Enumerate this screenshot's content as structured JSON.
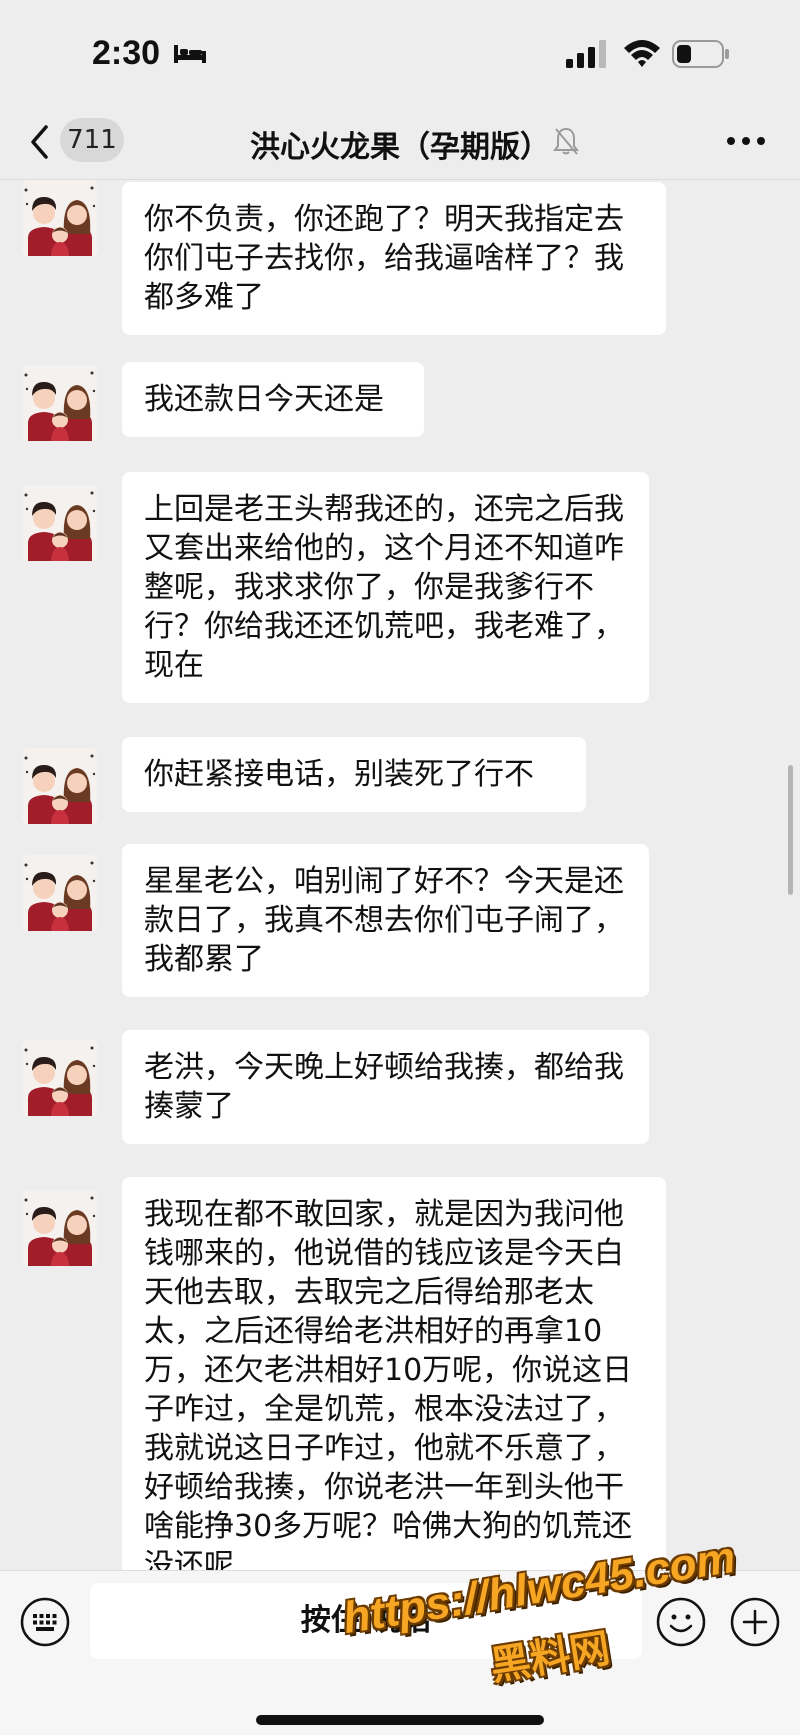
{
  "status_bar": {
    "time": "2:30",
    "icons": [
      "bed-icon",
      "signal-icon",
      "wifi-icon",
      "battery-icon"
    ]
  },
  "nav": {
    "unread_count": "711",
    "title": "洪心火龙果（孕期版）",
    "icons": [
      "back-icon",
      "mute-icon",
      "more-icon"
    ]
  },
  "messages": [
    {
      "text": "你不负责，你还跑了？明天我指定去你们屯子去找你，给我逼啥样了？我都多难了"
    },
    {
      "text": "我还款日今天还是"
    },
    {
      "text": "上回是老王头帮我还的，还完之后我又套出来给他的，这个月还不知道咋整呢，我求求你了，你是我爹行不行？你给我还还饥荒吧，我老难了，现在"
    },
    {
      "text": "你赶紧接电话，别装死了行不"
    },
    {
      "text": "星星老公，咱别闹了好不？今天是还款日了，我真不想去你们屯子闹了，我都累了"
    },
    {
      "text": "老洪，今天晚上好顿给我揍，都给我揍蒙了"
    },
    {
      "text": "我现在都不敢回家，就是因为我问他钱哪来的，他说借的钱应该是今天白天他去取，去取完之后得给那老太太，之后还得给老洪相好的再拿10万，还欠老洪相好10万呢，你说这日子咋过，全是饥荒，根本没法过了，我就说这日子咋过，他就不乐意了，好顿给我揍，你说老洪一年到头他干啥能挣30多万呢？哈佛大狗的饥荒还没还呢"
    }
  ],
  "input_bar": {
    "voice_label": "按住 说话",
    "icons": [
      "keyboard-icon",
      "emoji-icon",
      "plus-icon"
    ]
  },
  "watermark": {
    "url": "https://hlwc45.com",
    "site": "黑料网"
  },
  "colors": {
    "background": "#ededed",
    "bubble": "#ffffff",
    "watermark": "#f6a623"
  }
}
